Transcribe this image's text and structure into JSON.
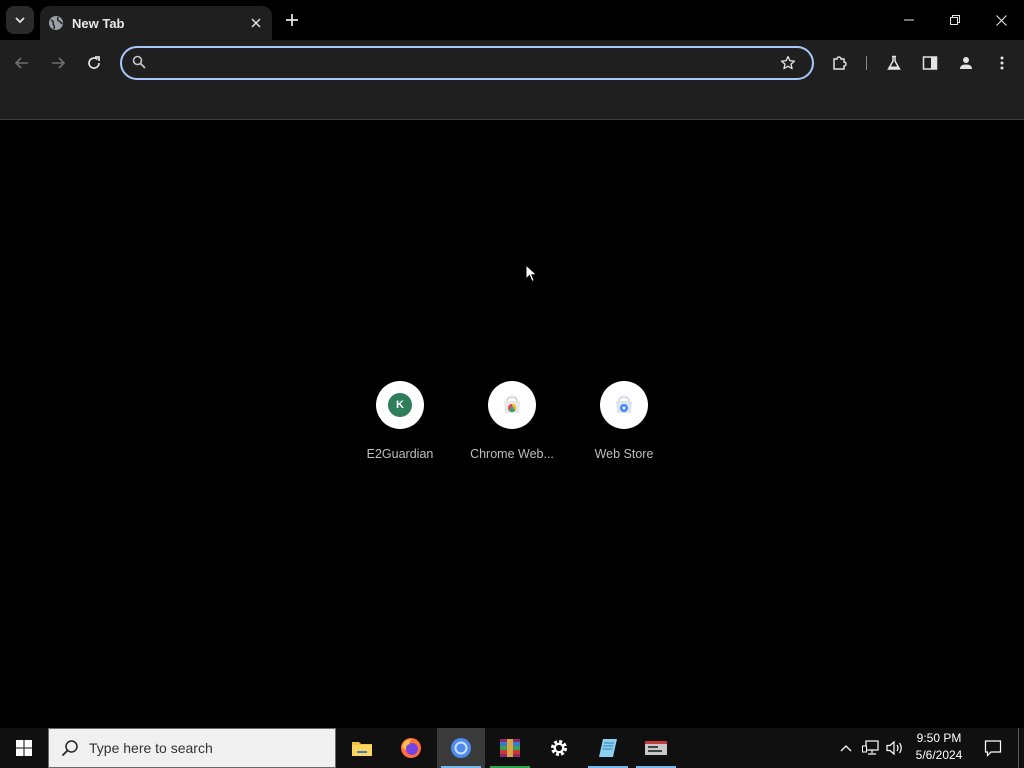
{
  "browser": {
    "tab": {
      "title": "New Tab"
    },
    "omnibox": {
      "value": "",
      "placeholder": ""
    }
  },
  "shortcuts": [
    {
      "label": "E2Guardian",
      "badge": "K"
    },
    {
      "label": "Chrome Web..."
    },
    {
      "label": "Web Store"
    }
  ],
  "taskbar": {
    "search_placeholder": "Type here to search",
    "time": "9:50 PM",
    "date": "5/6/2024"
  },
  "colors": {
    "accent": "#a8c7fa",
    "toolbar_bg": "#1f1f1f",
    "page_bg": "#000000",
    "taskbar_bg": "#101010",
    "shortcut_badge": "#2e7d5b"
  }
}
